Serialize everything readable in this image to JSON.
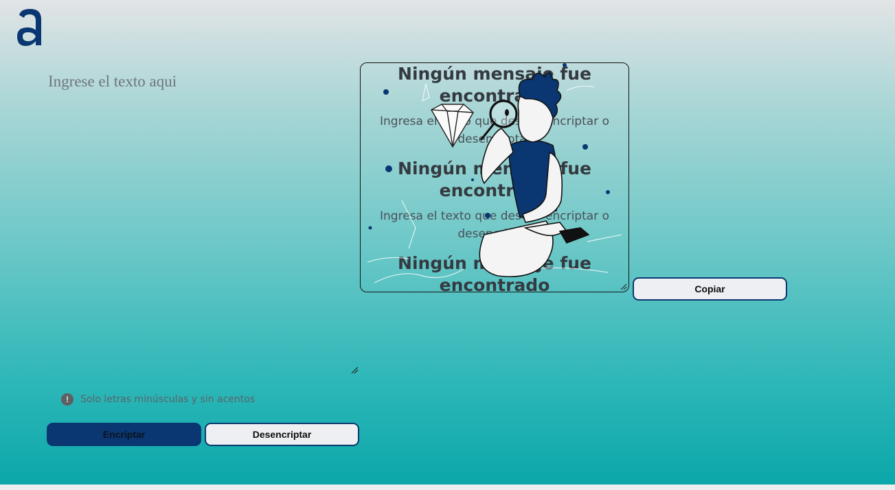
{
  "app": {
    "logo_icon": "alura-a-logo-icon"
  },
  "input": {
    "placeholder": "Ingrese el texto aqui",
    "value": ""
  },
  "hint": {
    "icon": "exclamation-circle-icon",
    "text": "Solo letras minúsculas y sin acentos"
  },
  "buttons": {
    "encrypt": "Encriptar",
    "decrypt": "Desencriptar",
    "copy": "Copiar"
  },
  "output": {
    "title_line1": "Ningún mensaje fue",
    "title_line2": "encontrado",
    "subtitle_line1": "Ingresa el texto que desees encriptar o",
    "subtitle_line2": "desencriptar",
    "illustration": "person-with-magnifying-glass-illustration"
  },
  "colors": {
    "primary": "#0a3771",
    "button_light": "#eeeff2",
    "gradient_top": "#e2e4e6",
    "gradient_bottom": "#0ba7aa"
  }
}
